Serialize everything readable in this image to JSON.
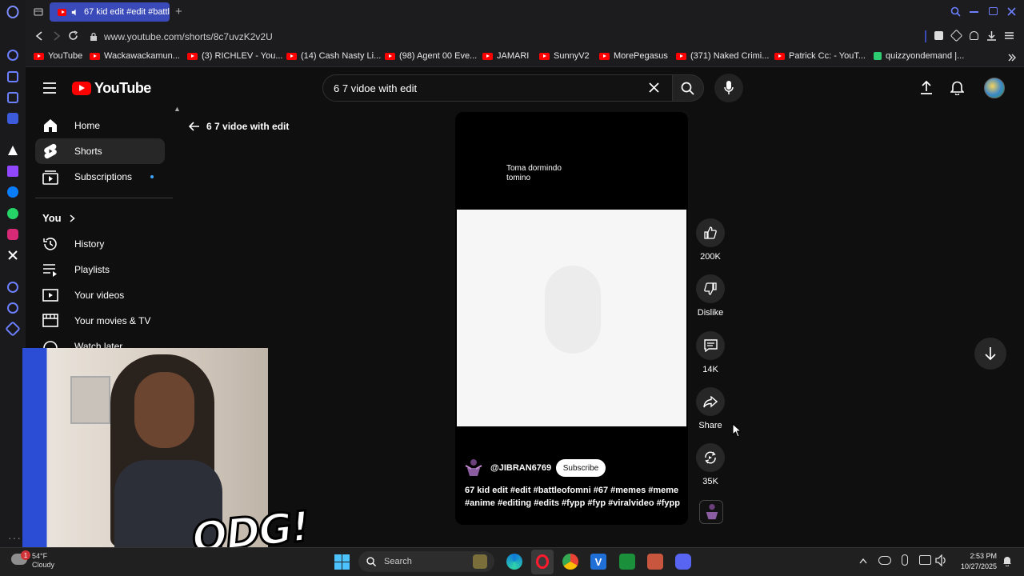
{
  "browser": {
    "tab_title": "67 kid edit #edit #battl",
    "url": "www.youtube.com/shorts/8c7uvzK2v2U",
    "bookmarks": [
      "YouTube",
      "Wackawackamun...",
      "(3) RICHLEV - You...",
      "(14) Cash Nasty Li...",
      "(98) Agent 00 Eve...",
      "JAMARI",
      "SunnyV2",
      "MorePegasus",
      "(371) Naked Crimi...",
      "Patrick Cc: - YouT...",
      "quizzyondemand |..."
    ]
  },
  "youtube": {
    "logo_text": "YouTube",
    "search_value": "6 7 vidoe with edit",
    "back_label": "6 7 vidoe with edit",
    "sidebar": {
      "items": [
        "Home",
        "Shorts",
        "Subscriptions"
      ],
      "you_label": "You",
      "you_items": [
        "History",
        "Playlists",
        "Your videos",
        "Your movies & TV",
        "Watch later"
      ]
    },
    "short": {
      "caption_line1": "Toma dormindo",
      "caption_line2": "tomino",
      "channel": "@JIBRAN6769",
      "subscribe_label": "Subscribe",
      "desc_line1": "67 kid edit #edit #battleofomni #67 #memes #meme",
      "desc_line2": "#anime #editing #edits #fypp #fyp #viralvideo #fypp"
    },
    "actions": {
      "like_count": "200K",
      "dislike_label": "Dislike",
      "comments_count": "14K",
      "share_label": "Share",
      "remix_count": "35K"
    }
  },
  "overlay": {
    "logo_text": "ODG!"
  },
  "taskbar": {
    "weather_temp": "54°F",
    "weather_desc": "Cloudy",
    "search_label": "Search",
    "time": "2:53 PM",
    "date": "10/27/2025",
    "notification_count": "1"
  },
  "colors": {
    "yt_red": "#ff0000",
    "tab_active": "#3a4ab8",
    "sidebar_active": "#272727"
  }
}
